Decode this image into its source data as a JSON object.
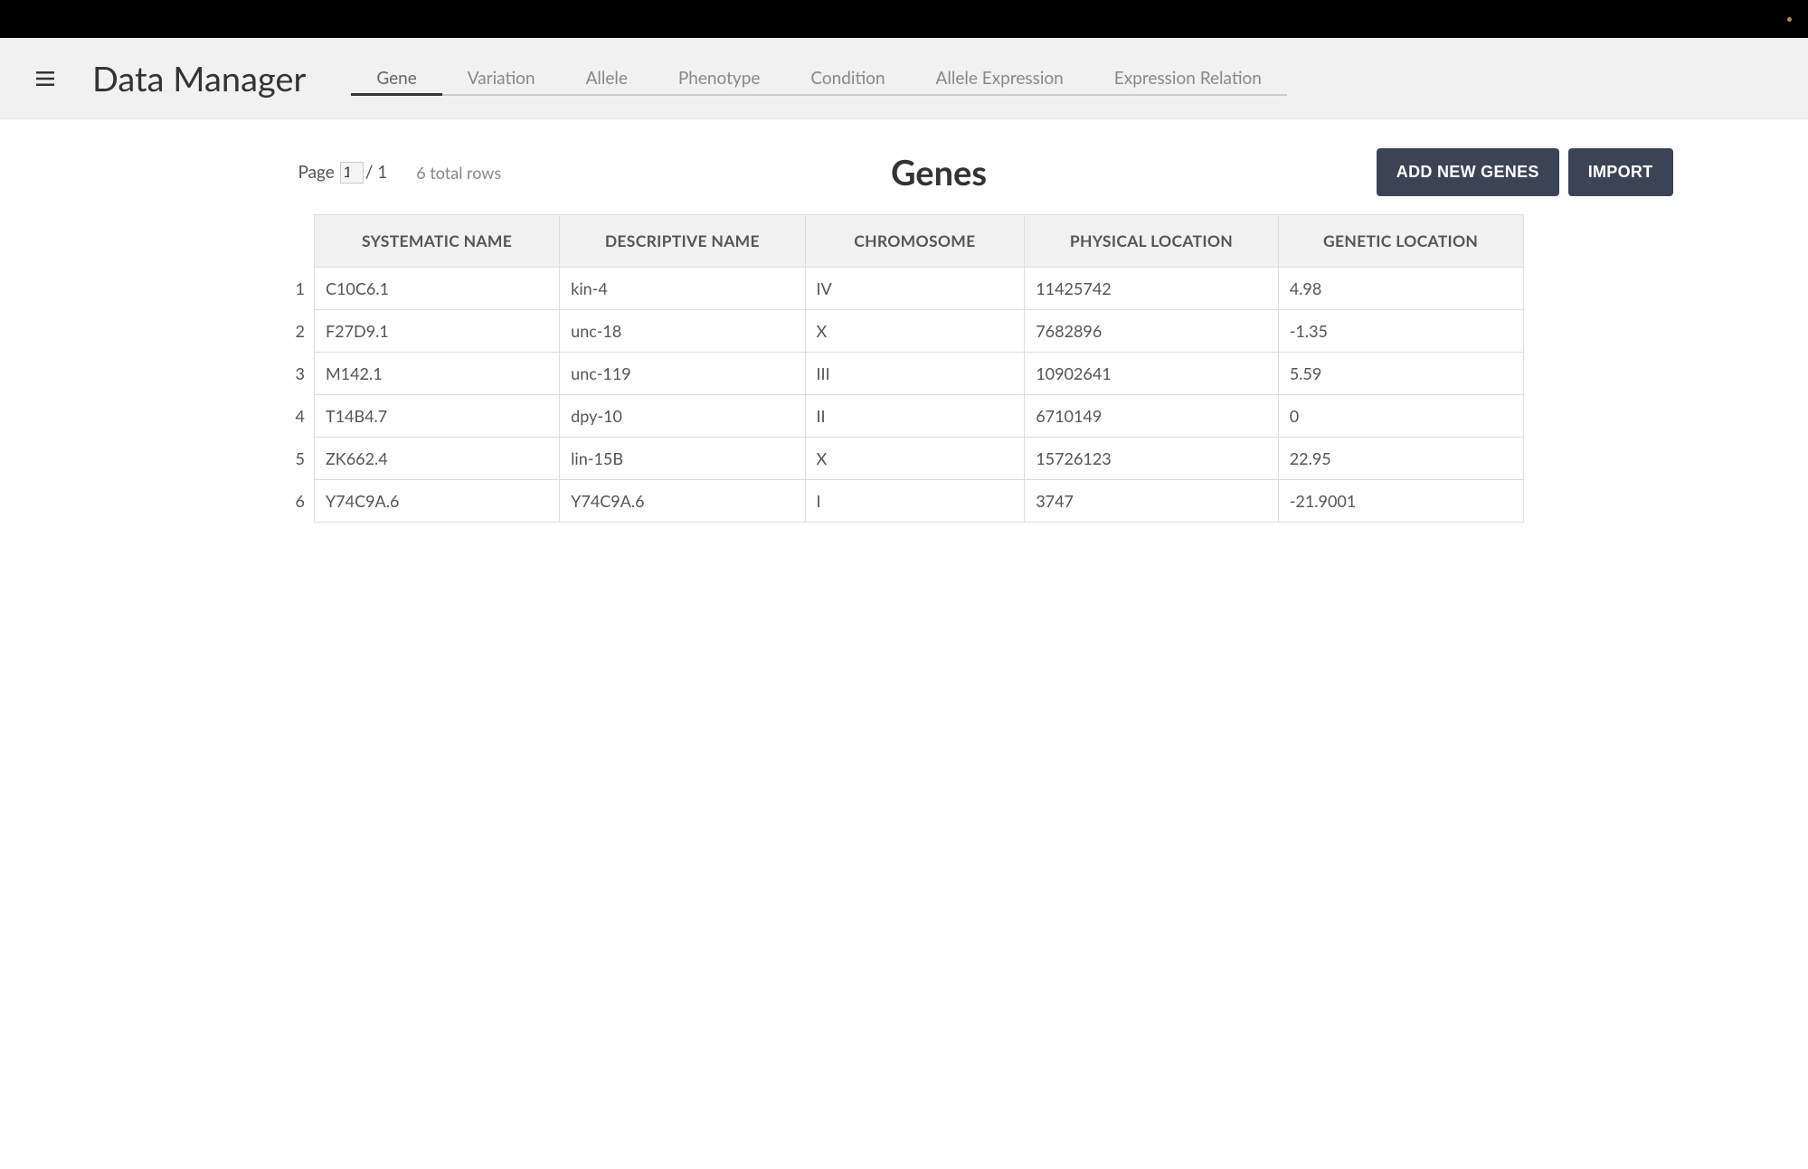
{
  "app": {
    "title": "Data Manager"
  },
  "tabs": {
    "items": [
      {
        "label": "Gene",
        "active": true
      },
      {
        "label": "Variation",
        "active": false
      },
      {
        "label": "Allele",
        "active": false
      },
      {
        "label": "Phenotype",
        "active": false
      },
      {
        "label": "Condition",
        "active": false
      },
      {
        "label": "Allele Expression",
        "active": false
      },
      {
        "label": "Expression Relation",
        "active": false
      }
    ]
  },
  "pagination": {
    "page_label": "Page",
    "current": "1",
    "total": "/ 1",
    "rows_text": "6 total rows"
  },
  "page": {
    "title": "Genes"
  },
  "buttons": {
    "add": "ADD NEW GENES",
    "import": "IMPORT"
  },
  "table": {
    "headers": {
      "systematic": "SYSTEMATIC NAME",
      "descriptive": "DESCRIPTIVE NAME",
      "chromosome": "CHROMOSOME",
      "physical": "PHYSICAL LOCATION",
      "genetic": "GENETIC LOCATION"
    },
    "rows": [
      {
        "n": "1",
        "systematic": "C10C6.1",
        "descriptive": "kin-4",
        "chromosome": "IV",
        "physical": "11425742",
        "genetic": "4.98"
      },
      {
        "n": "2",
        "systematic": "F27D9.1",
        "descriptive": "unc-18",
        "chromosome": "X",
        "physical": "7682896",
        "genetic": "-1.35"
      },
      {
        "n": "3",
        "systematic": "M142.1",
        "descriptive": "unc-119",
        "chromosome": "III",
        "physical": "10902641",
        "genetic": "5.59"
      },
      {
        "n": "4",
        "systematic": "T14B4.7",
        "descriptive": "dpy-10",
        "chromosome": "II",
        "physical": "6710149",
        "genetic": "0"
      },
      {
        "n": "5",
        "systematic": "ZK662.4",
        "descriptive": "lin-15B",
        "chromosome": "X",
        "physical": "15726123",
        "genetic": "22.95"
      },
      {
        "n": "6",
        "systematic": "Y74C9A.6",
        "descriptive": "Y74C9A.6",
        "chromosome": "I",
        "physical": "3747",
        "genetic": "-21.9001"
      }
    ]
  }
}
